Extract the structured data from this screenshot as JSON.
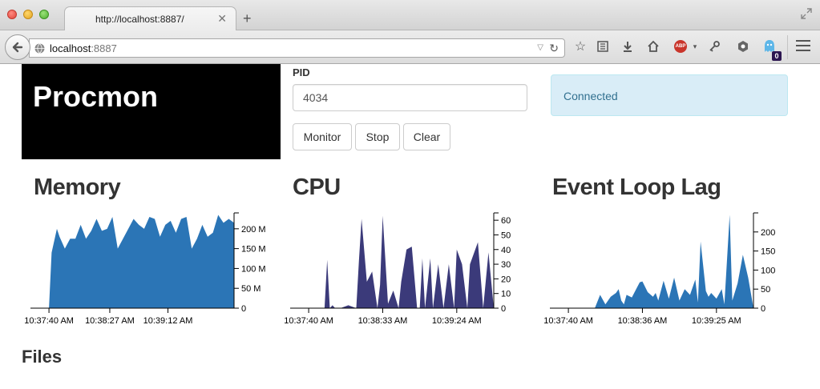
{
  "browser": {
    "tab_title": "http://localhost:8887/",
    "url_host": "localhost",
    "url_port": ":8887",
    "badge_count": "0"
  },
  "brand": {
    "title": "Procmon"
  },
  "pid": {
    "label": "PID",
    "value": "4034"
  },
  "buttons": {
    "monitor": "Monitor",
    "stop": "Stop",
    "clear": "Clear"
  },
  "status": {
    "text": "Connected",
    "color": "#d9edf7"
  },
  "sections": {
    "memory": "Memory",
    "cpu": "CPU",
    "lag": "Event Loop Lag",
    "files": "Files"
  },
  "chart_data": [
    {
      "type": "area",
      "name": "memory",
      "color": "#2b75b6",
      "ylim": [
        0,
        240
      ],
      "yticks": [
        0,
        50,
        100,
        150,
        200
      ],
      "ytick_labels": [
        "0",
        "50 M",
        "100 M",
        "150 M",
        "200 M"
      ],
      "xlim": [
        -7,
        70
      ],
      "xticks": [
        0,
        23,
        45
      ],
      "xtick_labels": [
        "10:37:40 AM",
        "10:38:27 AM",
        "10:39:12 AM"
      ],
      "x": [
        -7,
        0,
        1,
        3,
        4,
        6,
        8,
        10,
        12,
        14,
        16,
        18,
        20,
        22,
        24,
        26,
        28,
        30,
        32,
        34,
        36,
        38,
        40,
        42,
        44,
        46,
        48,
        50,
        52,
        54,
        56,
        58,
        60,
        62,
        64,
        66,
        68,
        70
      ],
      "values": [
        0,
        0,
        140,
        200,
        180,
        150,
        175,
        175,
        210,
        175,
        195,
        225,
        195,
        200,
        230,
        150,
        175,
        200,
        225,
        210,
        200,
        230,
        225,
        180,
        210,
        220,
        190,
        225,
        230,
        150,
        175,
        210,
        180,
        190,
        235,
        215,
        225,
        215
      ]
    },
    {
      "type": "area",
      "name": "cpu",
      "color": "#3b3a7a",
      "ylim": [
        0,
        65
      ],
      "yticks": [
        0,
        10,
        20,
        30,
        40,
        50,
        60
      ],
      "ytick_labels": [
        "0",
        "10",
        "20",
        "30",
        "40",
        "50",
        "60"
      ],
      "xlim": [
        -7,
        70
      ],
      "xticks": [
        0,
        28,
        56
      ],
      "xtick_labels": [
        "10:37:40 AM",
        "10:38:33 AM",
        "10:39:24 AM"
      ],
      "x": [
        -7,
        6,
        7,
        8,
        9,
        10,
        12,
        15,
        18,
        19,
        20,
        22,
        24,
        26,
        27,
        28,
        30,
        32,
        34,
        35,
        37,
        39,
        41,
        42,
        43,
        44,
        46,
        47,
        49,
        51,
        53,
        55,
        56,
        58,
        60,
        61,
        64,
        66,
        68,
        70
      ],
      "values": [
        0,
        0,
        33,
        0,
        2,
        0,
        0,
        2,
        0,
        32,
        61,
        18,
        25,
        0,
        16,
        63,
        3,
        12,
        0,
        18,
        40,
        42,
        0,
        0,
        34,
        0,
        34,
        0,
        30,
        0,
        30,
        0,
        40,
        30,
        0,
        30,
        45,
        0,
        38,
        0
      ]
    },
    {
      "type": "area",
      "name": "event-loop-lag",
      "color": "#2b75b6",
      "ylim": [
        0,
        250
      ],
      "yticks": [
        0,
        50,
        100,
        150,
        200
      ],
      "ytick_labels": [
        "0",
        "50",
        "100",
        "150",
        "200"
      ],
      "xlim": [
        -7,
        70
      ],
      "xticks": [
        0,
        28,
        56
      ],
      "xtick_labels": [
        "10:37:40 AM",
        "10:38:36 AM",
        "10:39:25 AM"
      ],
      "x": [
        -7,
        10,
        12,
        14,
        16,
        18,
        19,
        20,
        21,
        22,
        24,
        26,
        27,
        28,
        30,
        32,
        33,
        34,
        36,
        38,
        40,
        42,
        44,
        46,
        48,
        49,
        50,
        52,
        53,
        54,
        56,
        58,
        59,
        61,
        62,
        64,
        66,
        68,
        70
      ],
      "values": [
        0,
        0,
        35,
        10,
        30,
        40,
        50,
        20,
        10,
        35,
        28,
        55,
        68,
        70,
        42,
        30,
        40,
        20,
        72,
        25,
        80,
        20,
        50,
        35,
        75,
        15,
        175,
        45,
        30,
        40,
        25,
        50,
        10,
        245,
        20,
        65,
        140,
        80,
        0
      ]
    }
  ]
}
